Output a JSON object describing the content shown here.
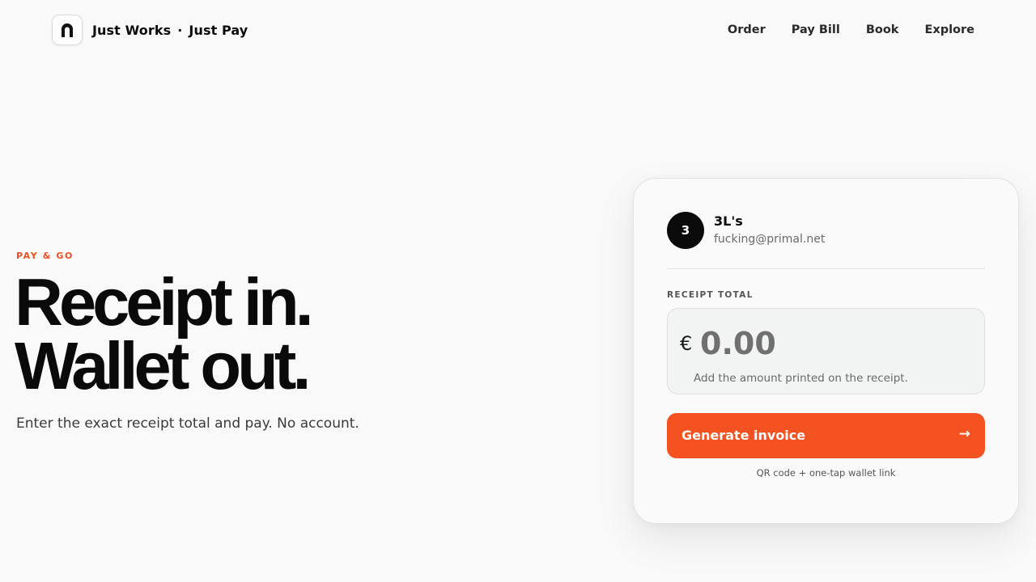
{
  "header": {
    "brand_primary": "Just Works",
    "brand_separator": "·",
    "brand_secondary": "Just Pay",
    "nav": [
      {
        "label": "Order"
      },
      {
        "label": "Pay Bill"
      },
      {
        "label": "Book"
      },
      {
        "label": "Explore"
      }
    ]
  },
  "hero": {
    "eyebrow": "PAY & GO",
    "headline_line1": "Receipt in.",
    "headline_line2": "Wallet out.",
    "subline": "Enter the exact receipt total and pay. No account."
  },
  "card": {
    "merchant": {
      "avatar_initial": "3",
      "name": "3L's",
      "email": "fucking@primal.net"
    },
    "field_label": "RECEIPT TOTAL",
    "currency_symbol": "€",
    "amount_value": "",
    "amount_placeholder": "0.00",
    "amount_hint": "Add the amount printed on the receipt.",
    "cta_label": "Generate invoice",
    "cta_arrow": "→",
    "cta_note": "QR code + one-tap wallet link"
  },
  "colors": {
    "accent": "#f55222",
    "background": "#f9f9f9",
    "text": "#0b0b0b"
  },
  "icons": {
    "logo": "arch-logo-icon",
    "cta": "arrow-right-icon"
  }
}
